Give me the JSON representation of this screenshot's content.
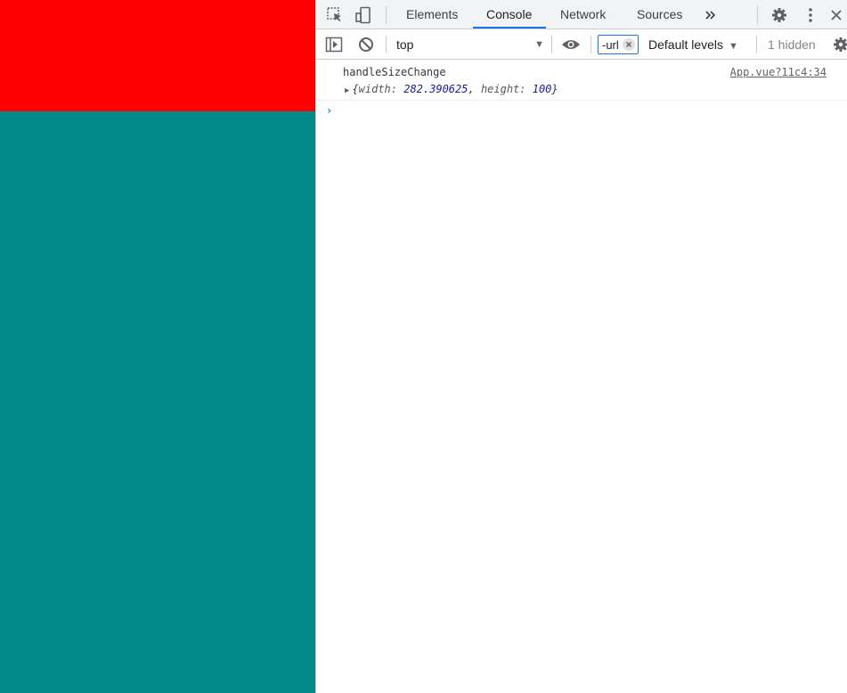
{
  "page": {
    "top_color": "#ff0000",
    "bottom_color": "#008a89"
  },
  "devtools": {
    "tabs": [
      {
        "label": "Elements"
      },
      {
        "label": "Console"
      },
      {
        "label": "Network"
      },
      {
        "label": "Sources"
      }
    ],
    "active_tab": "Console",
    "more_tabs_icon": "double-chevron-right",
    "accent_color": "#1a73e8"
  },
  "toolbar": {
    "context": "top",
    "filter_value": "-url",
    "levels_label": "Default levels",
    "hidden_label": "1 hidden"
  },
  "console": {
    "messages": [
      {
        "text": "handleSizeChange",
        "source": "App.vue?11c4:34",
        "object": {
          "open": "{",
          "width_key": "width: ",
          "width_value": "282.390625",
          "sep": ", ",
          "height_key": "height: ",
          "height_value": "100",
          "close": "}"
        }
      }
    ],
    "prompt": "›"
  }
}
